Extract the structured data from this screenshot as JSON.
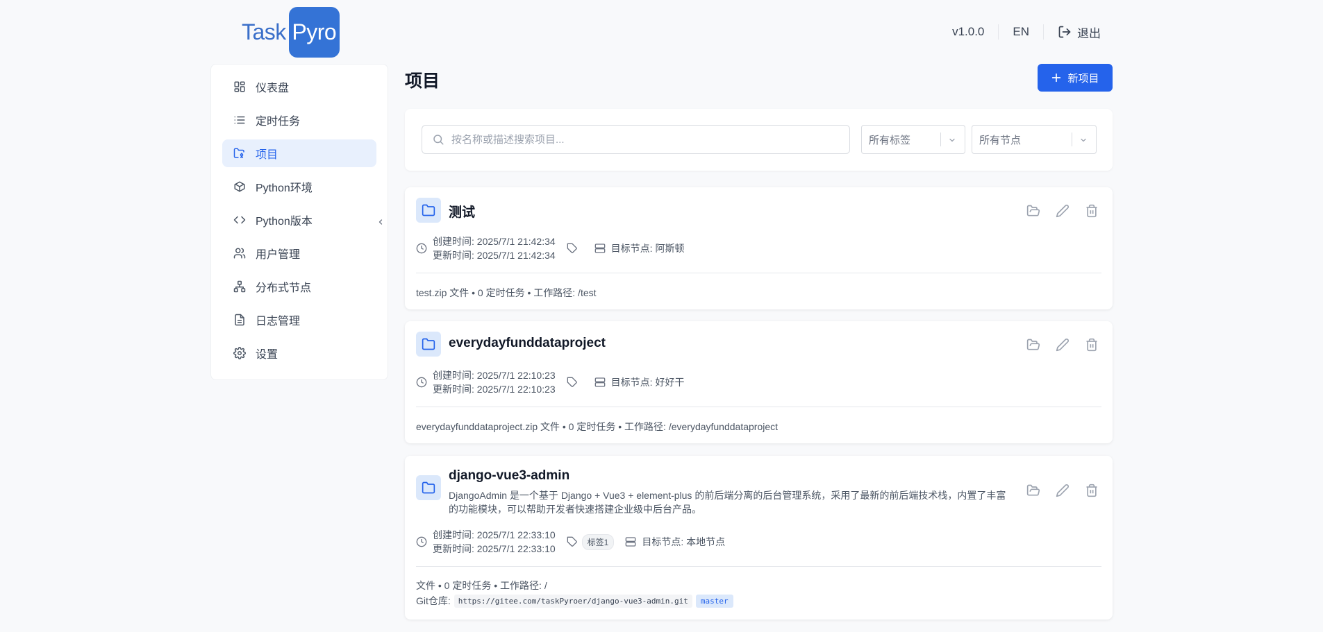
{
  "app": {
    "logo_left": "Task",
    "logo_right": "Pyro"
  },
  "header": {
    "version": "v1.0.0",
    "language": "EN",
    "logout": "退出"
  },
  "sidebar": {
    "items": [
      {
        "label": "仪表盘",
        "icon": "dashboard-icon"
      },
      {
        "label": "定时任务",
        "icon": "list-icon"
      },
      {
        "label": "项目",
        "icon": "folder-git-icon",
        "active": true
      },
      {
        "label": "Python环境",
        "icon": "box-icon"
      },
      {
        "label": "Python版本",
        "icon": "code-icon"
      },
      {
        "label": "用户管理",
        "icon": "users-icon"
      },
      {
        "label": "分布式节点",
        "icon": "network-icon"
      },
      {
        "label": "日志管理",
        "icon": "file-text-icon"
      },
      {
        "label": "设置",
        "icon": "gear-icon"
      }
    ]
  },
  "main": {
    "title": "项目",
    "new_button": "新项目",
    "search_placeholder": "按名称或描述搜索项目...",
    "tag_filter": "所有标签",
    "node_filter": "所有节点"
  },
  "projects": [
    {
      "name": "测试",
      "description": "",
      "created": "创建时间: 2025/7/1 21:42:34",
      "updated": "更新时间: 2025/7/1 21:42:34",
      "tags": [],
      "node": "目标节点: 阿斯顿",
      "footer": "test.zip 文件 • 0 定时任务 • 工作路径: /test"
    },
    {
      "name": "everydayfunddataproject",
      "description": "",
      "created": "创建时间: 2025/7/1 22:10:23",
      "updated": "更新时间: 2025/7/1 22:10:23",
      "tags": [],
      "node": "目标节点: 好好干",
      "footer": "everydayfunddataproject.zip 文件 • 0 定时任务 • 工作路径: /everydayfunddataproject"
    },
    {
      "name": "django-vue3-admin",
      "description": "DjangoAdmin 是一个基于 Django + Vue3 + element-plus 的前后端分离的后台管理系统，采用了最新的前后端技术栈，内置了丰富的功能模块，可以帮助开发者快速搭建企业级中后台产品。",
      "created": "创建时间: 2025/7/1 22:33:10",
      "updated": "更新时间: 2025/7/1 22:33:10",
      "tags": [
        "标签1"
      ],
      "node": "目标节点: 本地节点",
      "footer": "文件 • 0 定时任务 • 工作路径: /",
      "git_label": "Git仓库:",
      "git_url": "https://gitee.com/taskPyroer/django-vue3-admin.git",
      "git_branch": "master"
    }
  ],
  "colors": {
    "primary": "#2563eb",
    "active_bg": "#e8f0fd",
    "folder_bg": "#dbe8fb",
    "logo_bg": "#3473d6"
  }
}
